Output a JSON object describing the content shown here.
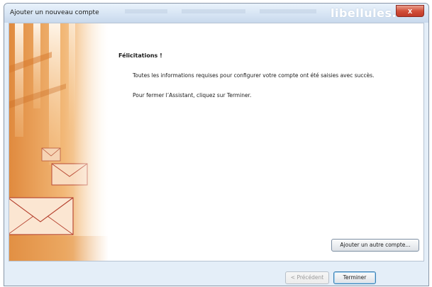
{
  "window": {
    "title": "Ajouter un nouveau compte",
    "watermark": "libellules.ch",
    "close_label": "x"
  },
  "content": {
    "heading": "Félicitations !",
    "paragraphs": [
      "Toutes les informations requises pour configurer votre compte ont été saisies avec succès.",
      "Pour fermer l’Assistant, cliquez sur Terminer."
    ],
    "add_another_label": "Ajouter un autre compte..."
  },
  "footer": {
    "previous_label": "< Précédent",
    "finish_label": "Terminer"
  },
  "colors": {
    "art_orange": "#e8a15a",
    "art_light": "#f7dcb8",
    "close_red": "#c8432f",
    "frame_blue": "#e4eef8"
  }
}
